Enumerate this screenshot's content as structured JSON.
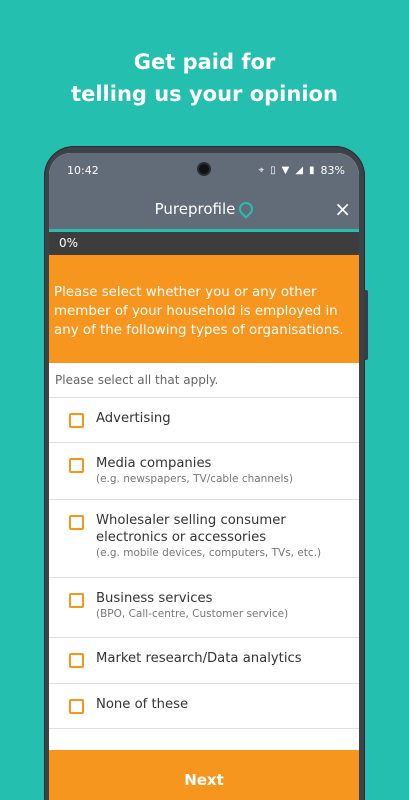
{
  "headline": {
    "line1": "Get paid for",
    "line2": "telling us your opinion"
  },
  "status": {
    "time": "10:42",
    "battery": "83%",
    "icons": [
      "location-icon",
      "vibrate-icon",
      "wifi-icon",
      "signal-icon",
      "battery-icon"
    ]
  },
  "appbar": {
    "brand": "Pureprofile",
    "close": "×"
  },
  "progress": {
    "label": "0%",
    "value": 0
  },
  "question": "Please select whether you or any other member of your household is employed in any of the following types of organisations.",
  "hint": "Please select all that apply.",
  "options": [
    {
      "label": "Advertising",
      "sub": ""
    },
    {
      "label": "Media companies",
      "sub": "(e.g. newspapers, TV/cable channels)"
    },
    {
      "label": "Wholesaler selling consumer electronics or accessories",
      "sub": "(e.g. mobile devices, computers, TVs, etc.)"
    },
    {
      "label": "Business services",
      "sub": "(BPO, Call-centre, Customer service)"
    },
    {
      "label": "Market research/Data analytics",
      "sub": ""
    },
    {
      "label": "None of these",
      "sub": ""
    }
  ],
  "next_label": "Next",
  "colors": {
    "background": "#24bfae",
    "accent": "#f6961e",
    "appbar": "#626b78"
  }
}
